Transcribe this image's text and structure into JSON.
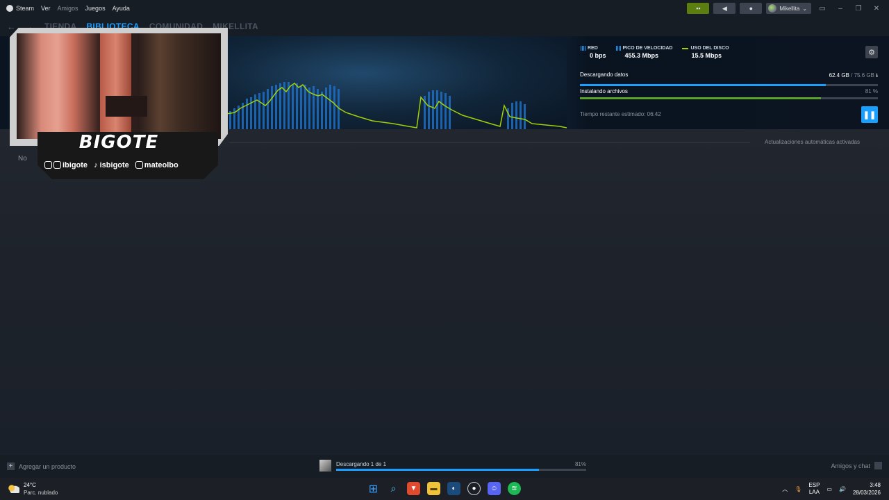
{
  "menu": {
    "app_name": "Steam",
    "items": [
      "Ver",
      "Amigos",
      "Juegos",
      "Ayuda"
    ]
  },
  "account": {
    "name": "Mikellita"
  },
  "nav": {
    "tabs": [
      "TIENDA",
      "BIBLIOTECA",
      "COMUNIDAD",
      "MIKELLITA"
    ],
    "active_tab": "BIBLIOTECA"
  },
  "downloads": {
    "stats": [
      {
        "label": "RED",
        "value": "0 bps"
      },
      {
        "label": "PICO DE VELOCIDAD",
        "value": "455.3 Mbps"
      },
      {
        "label": "USO DEL DISCO",
        "value": "15.5 Mbps"
      }
    ],
    "downloading_label": "Descargando datos",
    "downloaded": "62.4 GB",
    "total_sep": " / 75.6 GB",
    "download_progress": 0.825,
    "installing_label": "Instalando archivos",
    "install_percent": "81 %",
    "install_progress": 0.81,
    "eta_label": "Tiempo restante estimado: 06:42",
    "auto_updates": "Actualizaciones automáticas activadas",
    "partial_note": "No"
  },
  "overlay": {
    "brand": "BIGOTE",
    "socials": [
      "ibigote",
      "isbigote",
      "mateolbo"
    ]
  },
  "statusbar": {
    "add_product": "Agregar un producto",
    "download_text": "Descargando 1 de 1",
    "download_percent": "81%",
    "download_progress": 0.81,
    "friends": "Amigos y chat"
  },
  "taskbar": {
    "temp": "24°C",
    "condition": "Parc. nublado",
    "lang1": "ESP",
    "lang2": "LAA",
    "time": "3:48",
    "date": "28/03/2026"
  },
  "colors": {
    "accent": "#1a9fff",
    "install_green": "#5ba32b",
    "disk_line": "#a4d007"
  },
  "icons": [
    "steam-logo-icon",
    "back-arrow-icon",
    "forward-arrow-icon",
    "gear-icon",
    "pause-icon",
    "plus-icon",
    "friends-icon",
    "megaphone-icon",
    "bell-icon"
  ]
}
